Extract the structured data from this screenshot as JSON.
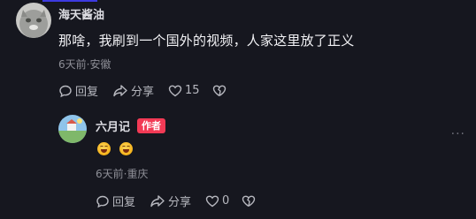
{
  "comment": {
    "username": "海天酱油",
    "text": "那啥，我刷到一个国外的视频，人家这里放了正义",
    "meta": "6天前·安徽",
    "reply_label": "回复",
    "share_label": "分享",
    "like_count": "15"
  },
  "reply": {
    "username": "六月记",
    "badge": "作者",
    "emojis": [
      "laughing-crying-emoji",
      "laughing-crying-emoji"
    ],
    "meta": "6天前·重庆",
    "reply_label": "回复",
    "share_label": "分享",
    "like_count": "0"
  },
  "more_label": "···"
}
